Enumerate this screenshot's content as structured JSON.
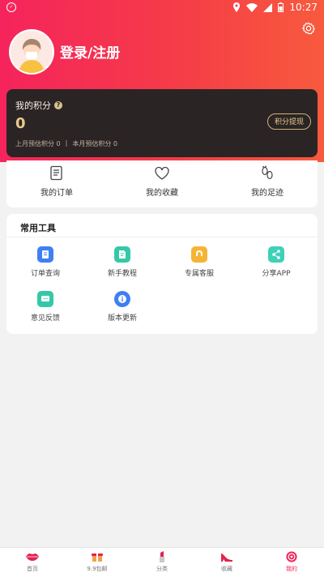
{
  "status_bar": {
    "time": "10:27"
  },
  "profile": {
    "login_label": "登录/注册"
  },
  "points": {
    "title": "我的积分",
    "value": "0",
    "withdraw_label": "积分提现",
    "last_month_label": "上月预估积分",
    "last_month_value": "0",
    "this_month_label": "本月预估积分",
    "this_month_value": "0"
  },
  "shortcuts": [
    {
      "label": "我的订单",
      "icon": "order-icon"
    },
    {
      "label": "我的收藏",
      "icon": "heart-icon"
    },
    {
      "label": "我的足迹",
      "icon": "footprint-icon"
    }
  ],
  "tools": {
    "title": "常用工具",
    "items": [
      {
        "label": "订单查询",
        "icon": "order-search-icon",
        "color": "#3f7ff3"
      },
      {
        "label": "新手教程",
        "icon": "tutorial-icon",
        "color": "#35c8a8"
      },
      {
        "label": "专属客服",
        "icon": "service-icon",
        "color": "#f6b437"
      },
      {
        "label": "分享APP",
        "icon": "share-icon",
        "color": "#3fd0b8"
      },
      {
        "label": "意见反馈",
        "icon": "feedback-icon",
        "color": "#35c8a8"
      },
      {
        "label": "版本更新",
        "icon": "info-icon",
        "color": "#3f7ff3"
      }
    ]
  },
  "tabbar": {
    "items": [
      {
        "label": "首页",
        "icon": "lips-icon"
      },
      {
        "label": "9.9包邮",
        "icon": "gift-icon"
      },
      {
        "label": "分类",
        "icon": "lipstick-icon"
      },
      {
        "label": "收藏",
        "icon": "heel-icon"
      },
      {
        "label": "我的",
        "icon": "profile-icon",
        "active": true
      }
    ]
  },
  "colors": {
    "accent": "#f2245a",
    "card_dark": "#2b2424",
    "gold": "#e7c98c"
  }
}
